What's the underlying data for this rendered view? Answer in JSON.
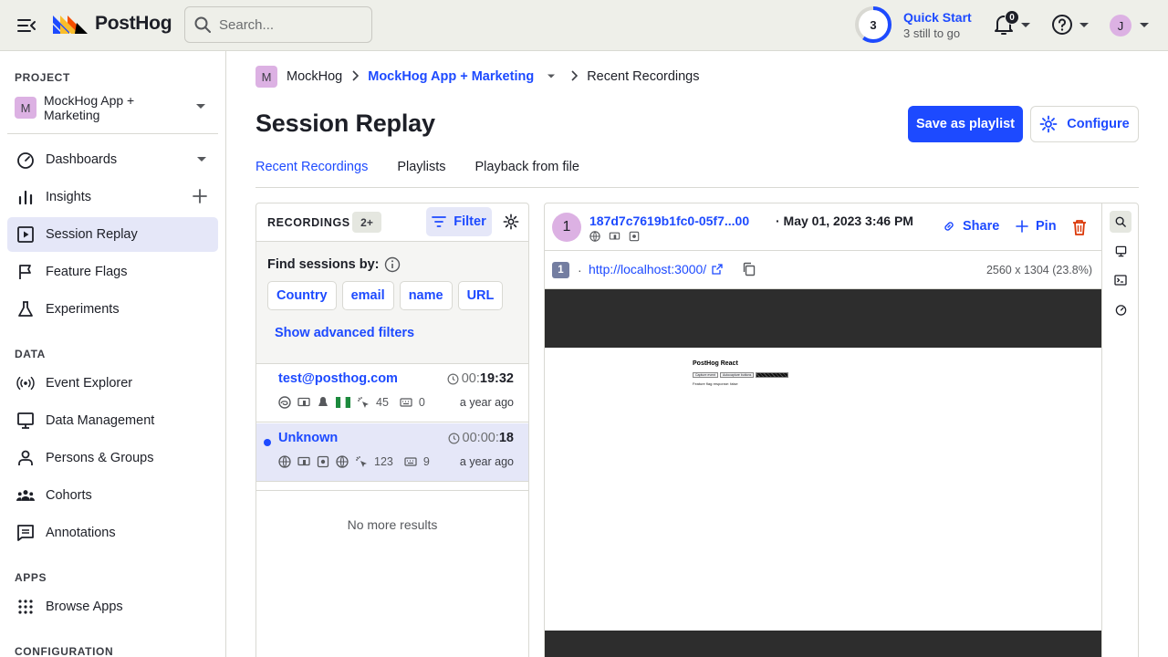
{
  "topbar": {
    "logo_text": "PostHog",
    "search_placeholder": "Search...",
    "quick_start": {
      "step": "3",
      "title": "Quick Start",
      "subtitle": "3 still to go",
      "progress": 0.6
    },
    "notifications_count": "0",
    "user_initial": "J"
  },
  "sidebar": {
    "project_heading": "PROJECT",
    "project_badge": "M",
    "project_name": "MockHog App + Marketing",
    "items": [
      {
        "label": "Dashboards",
        "icon": "gauge-icon"
      },
      {
        "label": "Insights",
        "icon": "bar-chart-icon"
      },
      {
        "label": "Session Replay",
        "icon": "play-square-icon"
      },
      {
        "label": "Feature Flags",
        "icon": "flag-icon"
      },
      {
        "label": "Experiments",
        "icon": "flask-icon"
      }
    ],
    "data_heading": "DATA",
    "data_items": [
      {
        "label": "Event Explorer",
        "icon": "broadcast-icon"
      },
      {
        "label": "Data Management",
        "icon": "monitor-icon"
      },
      {
        "label": "Persons & Groups",
        "icon": "person-icon"
      },
      {
        "label": "Cohorts",
        "icon": "people-icon"
      },
      {
        "label": "Annotations",
        "icon": "annotation-icon"
      }
    ],
    "apps_heading": "APPS",
    "apps_items": [
      {
        "label": "Browse Apps",
        "icon": "grid-dots-icon"
      }
    ],
    "config_heading": "CONFIGURATION"
  },
  "breadcrumb": {
    "org_badge": "M",
    "org": "MockHog",
    "project": "MockHog App + Marketing",
    "current": "Recent Recordings"
  },
  "page": {
    "title": "Session Replay",
    "save_playlist": "Save as playlist",
    "configure": "Configure",
    "tabs": [
      "Recent Recordings",
      "Playlists",
      "Playback from file"
    ]
  },
  "recordings": {
    "heading": "RECORDINGS",
    "count": "2+",
    "filter_label": "Filter",
    "find_label": "Find sessions by:",
    "chips": [
      "Country",
      "email",
      "name",
      "URL"
    ],
    "advanced": "Show advanced filters",
    "rows": [
      {
        "name": "test@posthog.com",
        "dur_dim": "00:",
        "dur_bold": "19:32",
        "clicks": "45",
        "keys": "0",
        "ago": "a year ago"
      },
      {
        "name": "Unknown",
        "dur_dim": "00:00:",
        "dur_bold": "18",
        "clicks": "123",
        "keys": "9",
        "ago": "a year ago"
      }
    ],
    "no_more": "No more results"
  },
  "player": {
    "avatar": "1",
    "session_id": "187d7c7619b1fc0-05f7...00",
    "date": "· May 01, 2023 3:46 PM",
    "share": "Share",
    "pin": "Pin",
    "url_index": "1",
    "url": "http://localhost:3000/",
    "resolution": "2560 x 1304 (23.8%)",
    "preview": {
      "title": "PostHog React",
      "btn1": "Capture event",
      "btn2": "Autocapture buttons",
      "text": "Feature flag response: false"
    }
  },
  "colors": {
    "accent": "#1d4aff",
    "danger": "#db3707",
    "active_bg": "#e5e7f8",
    "badge": "#dcb1e3"
  }
}
